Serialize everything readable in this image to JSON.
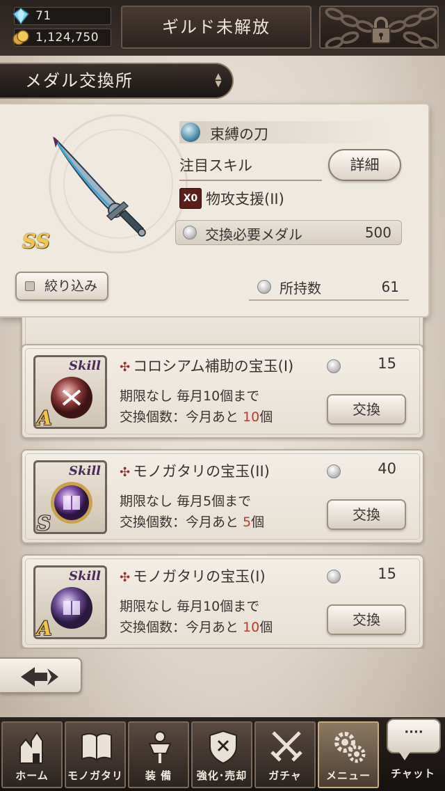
{
  "resources": {
    "gems": "71",
    "gold": "1,124,750"
  },
  "header": {
    "guild_button": "ギルド未解放",
    "title": "メダル交換所"
  },
  "detail": {
    "weapon_name": "束縛の刀",
    "weapon_rank": "SS",
    "focus_skill_label": "注目スキル",
    "detail_button": "詳細",
    "skill_chip": "X0",
    "skill_name": "物攻支援(II)",
    "required_medal_label": "交換必要メダル",
    "required_medal_value": "500",
    "filter_button": "絞り込み",
    "owned_label": "所持数",
    "owned_value": "61"
  },
  "items": [
    {
      "name": "コロシアム補助の宝玉(I)",
      "price": "15",
      "limit": "期限なし  毎月10個まで",
      "count_prefix": "交換個数：今月あと ",
      "count_num": "10",
      "count_suffix": "個",
      "button": "交換",
      "rank": "A",
      "skill_tag": "Skill",
      "orb_color": "#8c3a38"
    },
    {
      "name": "モノガタリの宝玉(II)",
      "price": "40",
      "limit": "期限なし  毎月5個まで",
      "count_prefix": "交換個数：今月あと ",
      "count_num": "5",
      "count_suffix": "個",
      "button": "交換",
      "rank": "S",
      "skill_tag": "Skill",
      "orb_color": "#7a4aa6"
    },
    {
      "name": "モノガタリの宝玉(I)",
      "price": "15",
      "limit": "期限なし  毎月10個まで",
      "count_prefix": "交換個数：今月あと ",
      "count_num": "10",
      "count_suffix": "個",
      "button": "交換",
      "rank": "A",
      "skill_tag": "Skill",
      "orb_color": "#6a4a92"
    }
  ],
  "nav": {
    "home": "ホーム",
    "story": "モノガタリ",
    "equip": "装 備",
    "enhance": "強化･売却",
    "gacha": "ガチャ",
    "menu": "メニュー",
    "chat_bubble": "····",
    "chat": "チャット"
  },
  "colors": {
    "accent_red": "#c0392b",
    "panel_bg": "#efe9e0",
    "nav_bg": "#2a221f"
  }
}
